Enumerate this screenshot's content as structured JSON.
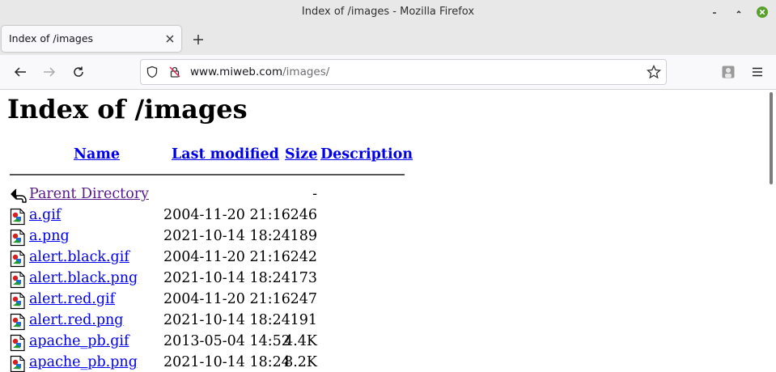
{
  "window": {
    "title": "Index of /images - Mozilla Firefox"
  },
  "tabs": [
    {
      "label": "Index of /images"
    }
  ],
  "navbar": {
    "url_host": "www.miweb.com",
    "url_path": "/images/"
  },
  "page": {
    "heading": "Index of /images",
    "columns": {
      "name": "Name",
      "last_modified": "Last modified",
      "size": "Size",
      "description": "Description"
    },
    "rows": [
      {
        "name": "Parent Directory",
        "date": "",
        "size": "-",
        "icon": "back-icon",
        "visited": true
      },
      {
        "name": "a.gif",
        "date": "2004-11-20 21:16",
        "size": "246",
        "icon": "image-file-icon"
      },
      {
        "name": "a.png",
        "date": "2021-10-14 18:24",
        "size": "189",
        "icon": "image-file-icon"
      },
      {
        "name": "alert.black.gif",
        "date": "2004-11-20 21:16",
        "size": "242",
        "icon": "image-file-icon"
      },
      {
        "name": "alert.black.png",
        "date": "2021-10-14 18:24",
        "size": "173",
        "icon": "image-file-icon"
      },
      {
        "name": "alert.red.gif",
        "date": "2004-11-20 21:16",
        "size": "247",
        "icon": "image-file-icon"
      },
      {
        "name": "alert.red.png",
        "date": "2021-10-14 18:24",
        "size": "191",
        "icon": "image-file-icon"
      },
      {
        "name": "apache_pb.gif",
        "date": "2013-05-04 14:52",
        "size": "4.4K",
        "icon": "image-file-icon"
      },
      {
        "name": "apache_pb.png",
        "date": "2021-10-14 18:24",
        "size": "8.2K",
        "icon": "image-file-icon"
      }
    ]
  },
  "colors": {
    "link": "#0000ee",
    "visited_link": "#551a8b",
    "close_button": "#5aa02c"
  }
}
